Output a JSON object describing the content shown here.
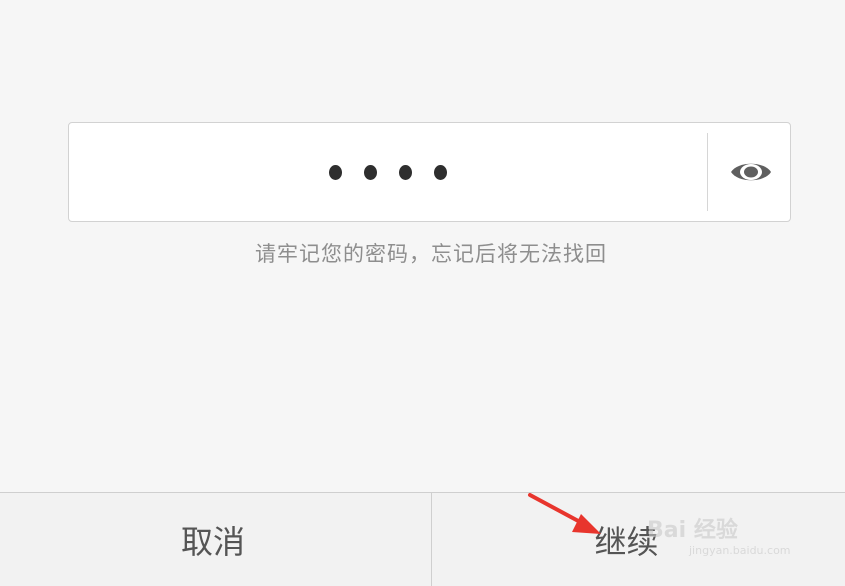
{
  "password": {
    "masked_length": 4,
    "toggle_icon": "eye-icon"
  },
  "hint": "请牢记您的密码，忘记后将无法找回",
  "buttons": {
    "cancel_label": "取消",
    "continue_label": "继续"
  },
  "watermark": {
    "logo": "Bai 经验",
    "url": "jingyan.baidu.com"
  },
  "colors": {
    "background": "#f6f6f6",
    "arrow": "#e8352d",
    "dot": "#2e2e2e",
    "button_text": "#555555",
    "hint_text": "#8e8e8e"
  }
}
